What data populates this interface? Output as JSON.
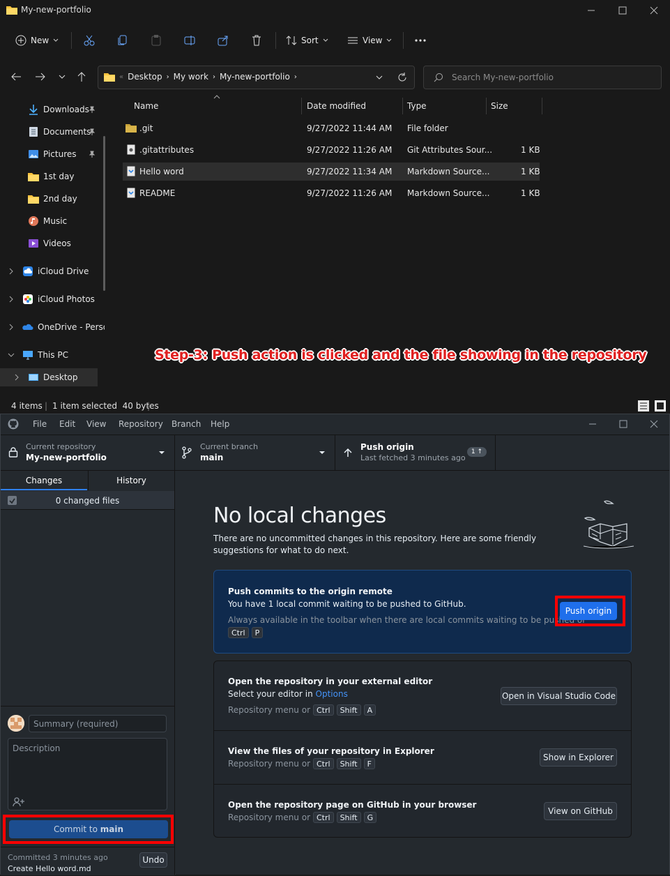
{
  "explorer": {
    "title": "My-new-portfolio",
    "toolbar": {
      "new_label": "New",
      "sort_label": "Sort",
      "view_label": "View"
    },
    "breadcrumbs": [
      "Desktop",
      "My work",
      "My-new-portfolio"
    ],
    "search_placeholder": "Search My-new-portfolio",
    "nav": [
      {
        "label": "Downloads",
        "icon": "download-icon",
        "pinned": true
      },
      {
        "label": "Documents",
        "icon": "document-icon",
        "pinned": true
      },
      {
        "label": "Pictures",
        "icon": "picture-icon",
        "pinned": true
      },
      {
        "label": "1st day",
        "icon": "folder-icon",
        "pinned": false
      },
      {
        "label": "2nd day",
        "icon": "folder-icon",
        "pinned": false
      },
      {
        "label": "Music",
        "icon": "music-icon",
        "pinned": false
      },
      {
        "label": "Videos",
        "icon": "video-icon",
        "pinned": false
      },
      {
        "label": "iCloud Drive",
        "icon": "icloud-drive-icon",
        "pinned": false
      },
      {
        "label": "iCloud Photos",
        "icon": "icloud-photos-icon",
        "pinned": false
      },
      {
        "label": "OneDrive - Perso",
        "icon": "onedrive-icon",
        "pinned": false
      },
      {
        "label": "This PC",
        "icon": "pc-icon",
        "pinned": false
      },
      {
        "label": "Desktop",
        "icon": "desktop-icon",
        "pinned": false
      }
    ],
    "columns": [
      "Name",
      "Date modified",
      "Type",
      "Size"
    ],
    "files": [
      {
        "name": ".git",
        "date": "9/27/2022 11:44 AM",
        "type": "File folder",
        "size": ""
      },
      {
        "name": ".gitattributes",
        "date": "9/27/2022 11:26 AM",
        "type": "Git Attributes Sour...",
        "size": "1 KB"
      },
      {
        "name": "Hello word",
        "date": "9/27/2022 11:34 AM",
        "type": "Markdown Source...",
        "size": "1 KB"
      },
      {
        "name": "README",
        "date": "9/27/2022 11:26 AM",
        "type": "Markdown Source...",
        "size": "1 KB"
      }
    ],
    "status": {
      "items": "4 items",
      "selected": "1 item selected  40 bytes"
    },
    "annotation": "Step-3: Push action is clicked and the file showing in the repository"
  },
  "github": {
    "menu": [
      "File",
      "Edit",
      "View",
      "Repository",
      "Branch",
      "Help"
    ],
    "repo": {
      "label": "Current repository",
      "value": "My-new-portfolio"
    },
    "branch": {
      "label": "Current branch",
      "value": "main"
    },
    "push": {
      "label": "Push origin",
      "sub": "Last fetched 3 minutes ago",
      "badge": "1 ↑"
    },
    "tabs": [
      "Changes",
      "History"
    ],
    "changed_files": "0 changed files",
    "summary_placeholder": "Summary (required)",
    "description_placeholder": "Description",
    "commit_prefix": "Commit to ",
    "commit_branch": "main",
    "last_commit": {
      "time": "Committed 3 minutes ago",
      "message": "Create Hello word.md",
      "undo": "Undo"
    },
    "main": {
      "title": "No local changes",
      "description": "There are no uncommitted changes in this repository. Here are some friendly suggestions for what to do next.",
      "push_card": {
        "heading": "Push commits to the origin remote",
        "text": "You have 1 local commit waiting to be pushed to GitHub.",
        "hint": "Always available in the toolbar when there are local commits waiting to be pushed or",
        "keys": [
          "Ctrl",
          "P"
        ],
        "button": "Push origin"
      },
      "editor_card": {
        "heading": "Open the repository in your external editor",
        "text_prefix": "Select your editor in ",
        "text_link": "Options",
        "hint": "Repository menu or",
        "keys": [
          "Ctrl",
          "Shift",
          "A"
        ],
        "button": "Open in Visual Studio Code"
      },
      "explorer_card": {
        "heading": "View the files of your repository in Explorer",
        "hint": "Repository menu or",
        "keys": [
          "Ctrl",
          "Shift",
          "F"
        ],
        "button": "Show in Explorer"
      },
      "github_card": {
        "heading": "Open the repository page on GitHub in your browser",
        "hint": "Repository menu or",
        "keys": [
          "Ctrl",
          "Shift",
          "G"
        ],
        "button": "View on GitHub"
      }
    }
  }
}
